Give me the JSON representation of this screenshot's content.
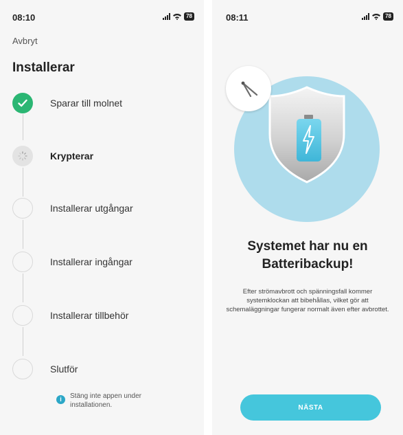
{
  "left": {
    "status_bar": {
      "time": "08:10",
      "battery": "78"
    },
    "cancel_label": "Avbryt",
    "title": "Installerar",
    "steps": [
      {
        "label": "Sparar till molnet",
        "state": "done"
      },
      {
        "label": "Krypterar",
        "state": "active"
      },
      {
        "label": "Installerar utgångar",
        "state": "pending"
      },
      {
        "label": "Installerar ingångar",
        "state": "pending"
      },
      {
        "label": "Installerar tillbehör",
        "state": "pending"
      },
      {
        "label": "Slutför",
        "state": "pending"
      }
    ],
    "notice": {
      "icon": "info-icon",
      "text": "Stäng inte appen under installationen."
    }
  },
  "right": {
    "status_bar": {
      "time": "08:11",
      "battery": "78"
    },
    "hero": {
      "icons": [
        "tool-icon",
        "shield-icon",
        "battery-bolt-icon"
      ]
    },
    "title": "Systemet har nu en Batteribackup!",
    "body": "Efter strömavbrott och spänningsfall kommer systemklockan att bibehållas, vilket gör att schemaläggningar fungerar normalt även efter avbrottet.",
    "next_button": "NÄSTA"
  },
  "colors": {
    "success": "#2bb673",
    "accent": "#45c6dc",
    "hero_bg": "#aedcec",
    "battery": "#4fc3e0",
    "info": "#2ca7c7"
  }
}
